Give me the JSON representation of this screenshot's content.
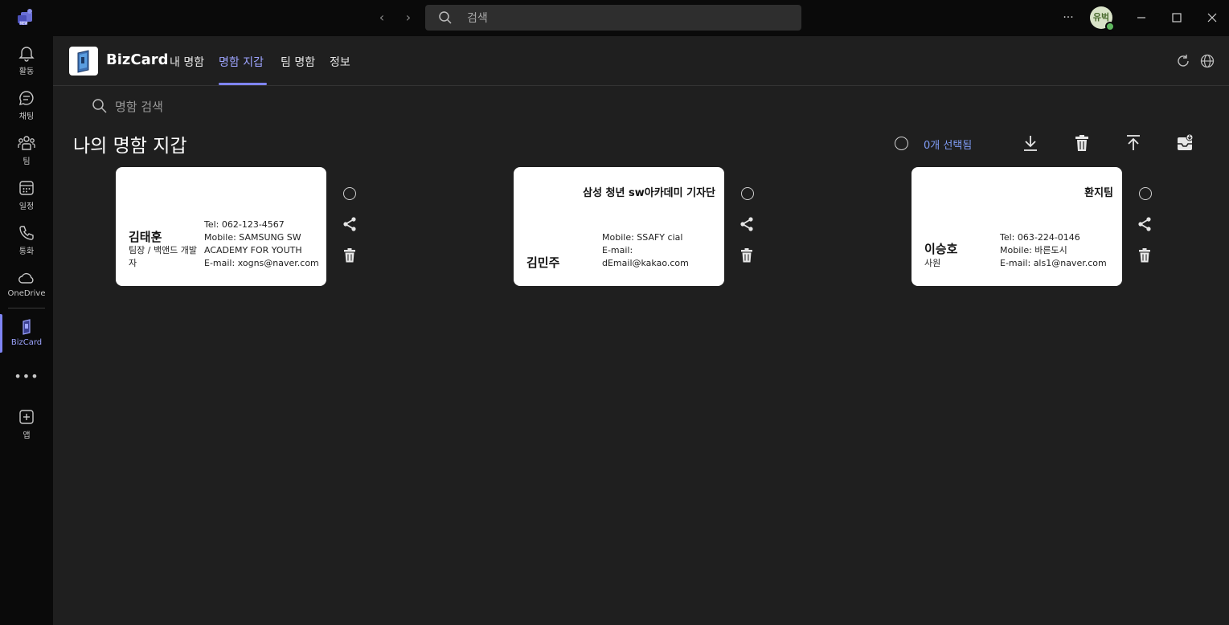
{
  "titlebar": {
    "search_placeholder": "검색",
    "avatar_text": "유벅"
  },
  "rail": {
    "items": [
      {
        "label": "활동",
        "icon": "bell-icon"
      },
      {
        "label": "채팅",
        "icon": "chat-icon"
      },
      {
        "label": "팀",
        "icon": "teams-icon"
      },
      {
        "label": "일정",
        "icon": "calendar-icon"
      },
      {
        "label": "통화",
        "icon": "phone-icon"
      },
      {
        "label": "OneDrive",
        "icon": "cloud-icon"
      },
      {
        "label": "BizCard",
        "icon": "bizcard-icon"
      },
      {
        "label": "앱",
        "icon": "add-app-icon"
      }
    ]
  },
  "app": {
    "name": "BizCard",
    "tabs": [
      "내 명함",
      "명함 지갑",
      "팀 명함",
      "정보"
    ],
    "active_tab": "명함 지갑",
    "accent": "#7f85f5"
  },
  "main": {
    "search_placeholder": "명함 검색",
    "title": "나의 명함 지갑",
    "selected_count": "0개 선택됨"
  },
  "cards": [
    {
      "company": "",
      "name": "김태훈",
      "title": "팀장 / 백앤드 개발자",
      "info": [
        "Tel: 062-123-4567",
        "Mobile: SAMSUNG SW ACADEMY FOR YOUTH",
        "E-mail: xogns@naver.com"
      ]
    },
    {
      "company": "삼성 청년 sw아카데미 기자단",
      "name": "김민주",
      "title": "",
      "info": [
        "Mobile: SSAFY cial",
        "E-mail: dEmail@kakao.com"
      ]
    },
    {
      "company": "환지팀",
      "name": "이승호",
      "title": "사원",
      "info": [
        "Tel: 063-224-0146",
        "Mobile: 바른도시",
        "E-mail: als1@naver.com"
      ]
    }
  ]
}
